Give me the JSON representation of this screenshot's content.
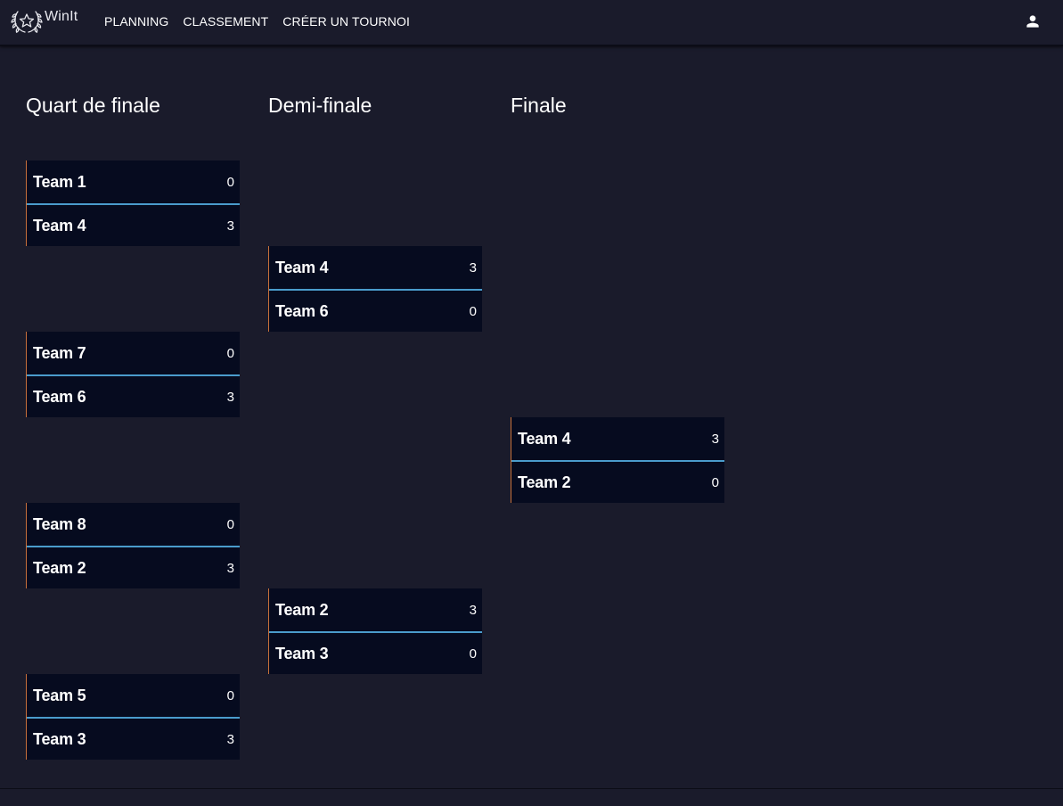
{
  "app": {
    "name": "WinIt"
  },
  "nav": {
    "items": [
      "PLANNING",
      "CLASSEMENT",
      "CRÉER UN TOURNOI"
    ]
  },
  "rounds": [
    {
      "title": "Quart de finale"
    },
    {
      "title": "Demi-finale"
    },
    {
      "title": "Finale"
    }
  ],
  "matches": [
    {
      "top": {
        "team": "Team 1",
        "score": "0"
      },
      "bottom": {
        "team": "Team 4",
        "score": "3"
      }
    },
    {
      "top": {
        "team": "Team 7",
        "score": "0"
      },
      "bottom": {
        "team": "Team 6",
        "score": "3"
      }
    },
    {
      "top": {
        "team": "Team 8",
        "score": "0"
      },
      "bottom": {
        "team": "Team 2",
        "score": "3"
      }
    },
    {
      "top": {
        "team": "Team 5",
        "score": "0"
      },
      "bottom": {
        "team": "Team 3",
        "score": "3"
      }
    },
    {
      "top": {
        "team": "Team 4",
        "score": "3"
      },
      "bottom": {
        "team": "Team 6",
        "score": "0"
      }
    },
    {
      "top": {
        "team": "Team 2",
        "score": "3"
      },
      "bottom": {
        "team": "Team 3",
        "score": "0"
      }
    },
    {
      "top": {
        "team": "Team 4",
        "score": "3"
      },
      "bottom": {
        "team": "Team 2",
        "score": "0"
      }
    }
  ],
  "colors": {
    "background": "#1a1b2b",
    "card": "#060b1f",
    "divider": "#4a9ccc",
    "card_accent": "#c8713a"
  },
  "icons": {
    "logo": "laurel-star-icon",
    "user": "user-icon"
  }
}
